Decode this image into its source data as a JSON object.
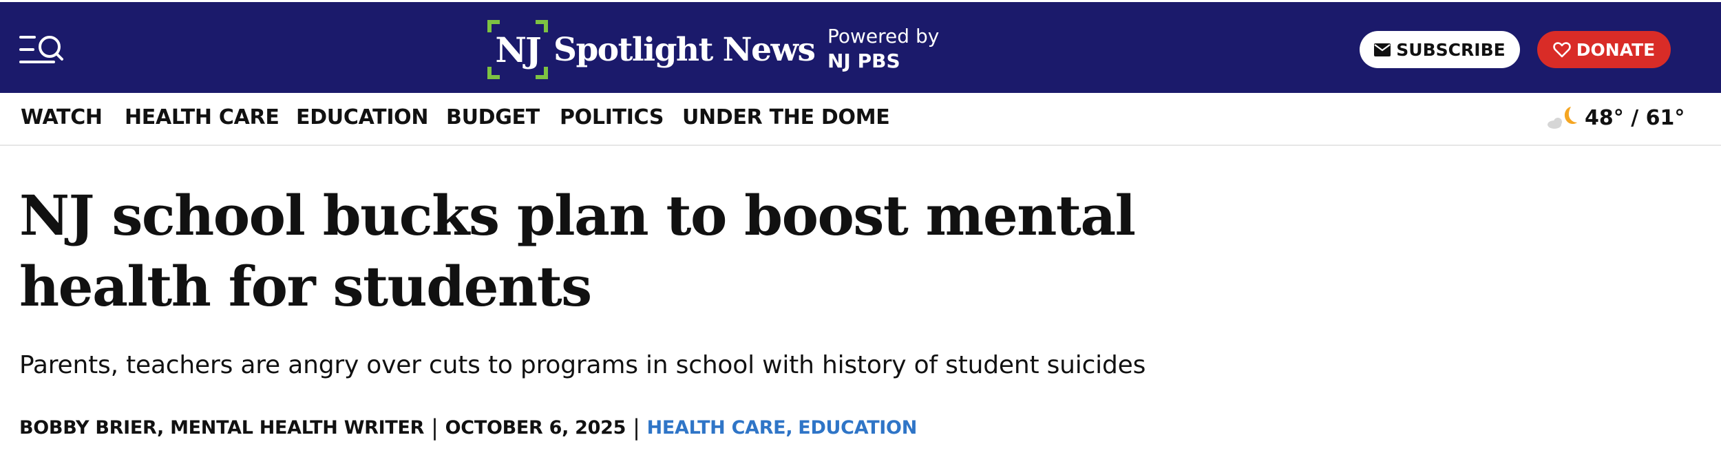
{
  "header": {
    "logo_mark": "NJ",
    "logo_text": "Spotlight News",
    "powered_by_label": "Powered by",
    "powered_by_name": "NJ PBS",
    "subscribe_label": "SUBSCRIBE",
    "donate_label": "DONATE",
    "colors": {
      "background": "#1b1a6b",
      "logo_accent": "#7dc242",
      "donate": "#d92c27"
    },
    "icons": {
      "menu": "menu-search-icon",
      "subscribe": "envelope-icon",
      "donate": "heart-outline-icon"
    }
  },
  "nav": {
    "items": [
      {
        "label": "WATCH"
      },
      {
        "label": "HEALTH CARE"
      },
      {
        "label": "EDUCATION"
      },
      {
        "label": "BUDGET"
      },
      {
        "label": "POLITICS"
      },
      {
        "label": "UNDER THE DOME"
      }
    ],
    "weather": {
      "icon": "partly-cloudy-moon-icon",
      "text": "48° / 61°"
    }
  },
  "article": {
    "headline": "NJ school bucks plan to boost mental health for students",
    "subhead": "Parents, teachers are angry over cuts to programs in school with history of student suicides",
    "author": "BOBBY BRIER, MENTAL HEALTH WRITER",
    "separator": "|",
    "date": "OCTOBER 6, 2025",
    "tags": [
      {
        "label": "HEALTH CARE,"
      },
      {
        "label": "EDUCATION"
      }
    ],
    "tag_color": "#2f75c7"
  }
}
